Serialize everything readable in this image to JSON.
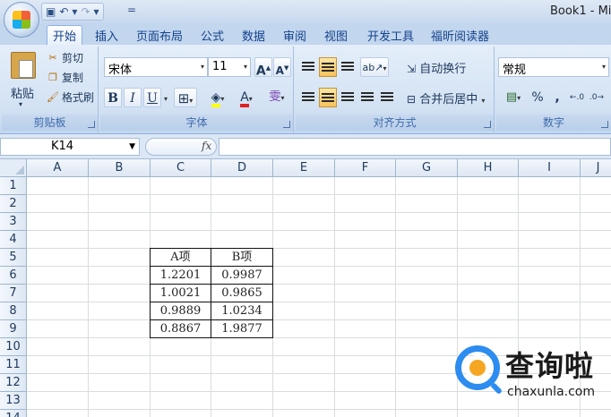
{
  "window": {
    "title": "Book1 - Mi"
  },
  "quick_access": {
    "save_icon": "save-icon",
    "undo_icon": "undo-icon",
    "redo_icon": "redo-icon",
    "customize": "="
  },
  "tabs": [
    {
      "label": "开始",
      "active": true
    },
    {
      "label": "插入"
    },
    {
      "label": "页面布局"
    },
    {
      "label": "公式"
    },
    {
      "label": "数据"
    },
    {
      "label": "审阅"
    },
    {
      "label": "视图"
    },
    {
      "label": "开发工具"
    },
    {
      "label": "福昕阅读器"
    }
  ],
  "ribbon": {
    "clipboard": {
      "label": "剪贴板",
      "paste": "粘贴",
      "cut": "剪切",
      "copy": "复制",
      "format_painter": "格式刷"
    },
    "font": {
      "label": "字体",
      "font_name": "宋体",
      "font_size": "11",
      "bold": "B",
      "italic": "I",
      "underline": "U",
      "font_color_glyph": "A",
      "wen_glyph": "雯"
    },
    "alignment": {
      "label": "对齐方式",
      "wrap_text": "自动换行",
      "merge_center": "合并后居中"
    },
    "number": {
      "label": "数字",
      "format": "常规",
      "percent": "%",
      "comma": ","
    }
  },
  "formula_bar": {
    "name_box": "K14",
    "fx": "fx",
    "value": ""
  },
  "grid": {
    "columns": [
      "A",
      "B",
      "C",
      "D",
      "E",
      "F",
      "G",
      "H",
      "I",
      "J"
    ],
    "rows": [
      "1",
      "2",
      "3",
      "4",
      "5",
      "6",
      "7",
      "8",
      "9",
      "10",
      "11",
      "12",
      "13",
      "14"
    ],
    "table": {
      "headers": [
        "A项",
        "B项"
      ],
      "rows": [
        [
          "1.2201",
          "0.9987"
        ],
        [
          "1.0021",
          "0.9865"
        ],
        [
          "0.9889",
          "1.0234"
        ],
        [
          "0.8867",
          "1.9877"
        ]
      ]
    }
  },
  "watermark": {
    "brand": "查询啦",
    "url": "chaxunla.com",
    "colors": {
      "blue": "#2d8cf0",
      "orange": "#f5a623"
    }
  }
}
